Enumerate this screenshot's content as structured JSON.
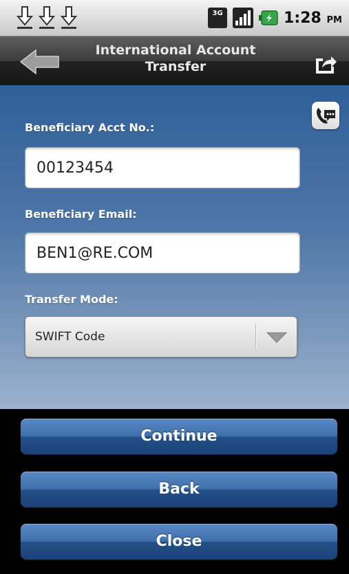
{
  "status_bar": {
    "network_type": "3G",
    "time": "1:28",
    "ampm": "PM",
    "icons": [
      "download-icon",
      "download-icon",
      "download-icon",
      "3g-icon",
      "signal-icon",
      "battery-icon"
    ]
  },
  "header": {
    "title": "International Account Transfer",
    "back_icon": "back-arrow-icon",
    "share_icon": "share-icon"
  },
  "form": {
    "contact_icon": "contact-icon",
    "acct_label": "Beneficiary Acct No.:",
    "acct_value": "00123454",
    "email_label": "Beneficiary Email:",
    "email_value": "BEN1@RE.COM",
    "mode_label": "Transfer Mode:",
    "mode_value": "SWIFT Code",
    "mode_icon": "chevron-down-icon"
  },
  "buttons": {
    "continue": "Continue",
    "back": "Back",
    "close": "Close"
  },
  "colors": {
    "form_bg_top": "#2f5f98",
    "form_bg_bottom": "#9cb2cd",
    "button_bg": "#2f5f9e",
    "title_bar_bg": "#3c3c3c",
    "battery_green": "#35a64a"
  }
}
